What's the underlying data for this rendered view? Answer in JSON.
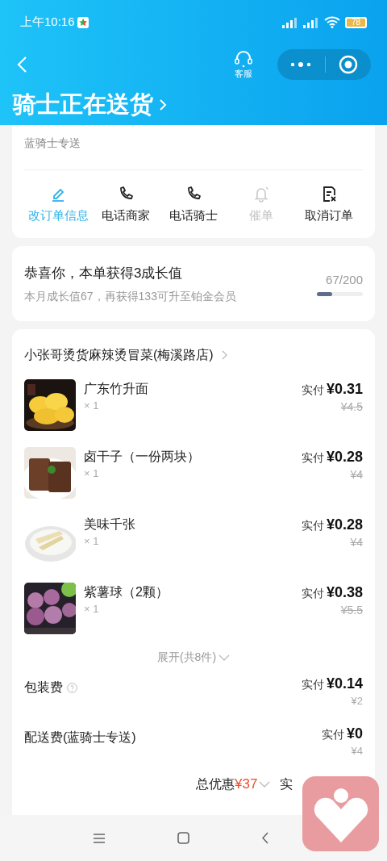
{
  "status_bar": {
    "time": "上午10:16",
    "battery": "78"
  },
  "nav": {
    "service_label": "客服"
  },
  "title": "骑士正在送货",
  "delivery_card": {
    "subtitle": "蓝骑士专送",
    "actions": [
      {
        "kind": "edit",
        "label": "改订单信息",
        "highlighted": true,
        "disabled": false
      },
      {
        "kind": "phone",
        "label": "电话商家",
        "highlighted": false,
        "disabled": false
      },
      {
        "kind": "phone",
        "label": "电话骑士",
        "highlighted": false,
        "disabled": false
      },
      {
        "kind": "bell",
        "label": "催单",
        "highlighted": false,
        "disabled": true
      },
      {
        "kind": "cancel",
        "label": "取消订单",
        "highlighted": false,
        "disabled": false
      }
    ]
  },
  "growth_card": {
    "title": "恭喜你，本单获得3成长值",
    "subtitle": "本月成长值67，再获得133可升至铂金会员",
    "progress_text": "67/200",
    "level": 0.335
  },
  "order_card": {
    "shop": "小张哥烫货麻辣烫冒菜(梅溪路店)",
    "items": [
      {
        "name": "广东竹升面",
        "qty": "× 1",
        "paid_label": "实付",
        "price": "¥0.31",
        "original": "¥4.5",
        "kind": "picture"
      },
      {
        "name": "卤干子（一份两块）",
        "qty": "× 1",
        "paid_label": "实付",
        "price": "¥0.28",
        "original": "¥4",
        "kind": "picture"
      },
      {
        "name": "美味千张",
        "qty": "× 1",
        "paid_label": "实付",
        "price": "¥0.28",
        "original": "¥4",
        "kind": "picture"
      },
      {
        "name": "紫薯球（2颗）",
        "qty": "× 1",
        "paid_label": "实付",
        "price": "¥0.38",
        "original": "¥5.5",
        "kind": "picture"
      }
    ],
    "expand": "展开(共8件)",
    "fees": [
      {
        "name": "包装费",
        "help": true,
        "paid_label": "实付",
        "price": "¥0.14",
        "original": "¥2"
      },
      {
        "name": "配送费(蓝骑士专送)",
        "help": false,
        "paid_label": "实付",
        "price": "¥0",
        "original": "¥4"
      }
    ],
    "discount_label": "总优惠",
    "discount": "¥37",
    "total_label": "实"
  }
}
